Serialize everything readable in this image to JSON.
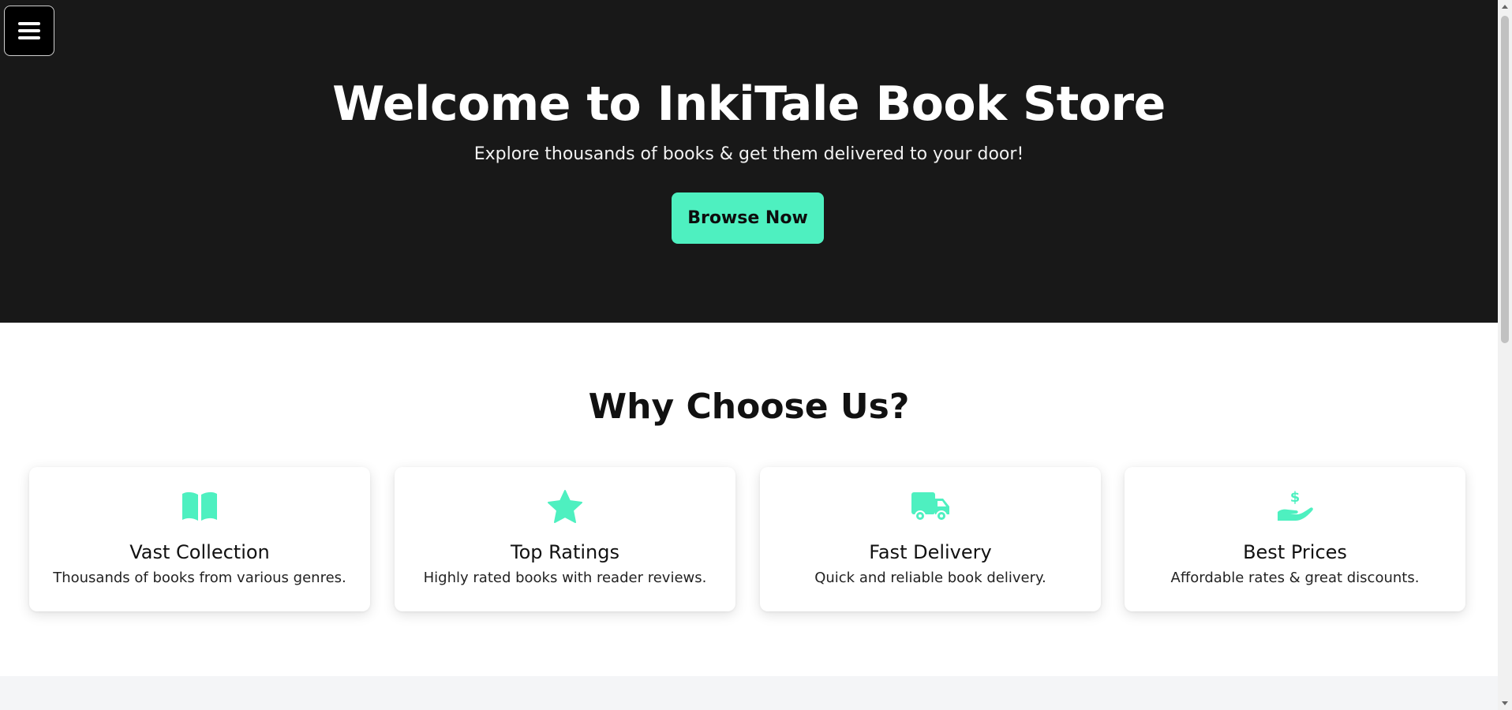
{
  "hero": {
    "title": "Welcome to InkiTale Book Store",
    "subtitle": "Explore thousands of books & get them delivered to your door!",
    "cta_label": "Browse Now",
    "background_color": "#181818"
  },
  "menu": {
    "icon": "hamburger-menu-icon"
  },
  "why": {
    "title": "Why Choose Us?",
    "features": [
      {
        "icon": "open-book-icon",
        "title": "Vast Collection",
        "description": "Thousands of books from various genres."
      },
      {
        "icon": "star-icon",
        "title": "Top Ratings",
        "description": "Highly rated books with reader reviews."
      },
      {
        "icon": "delivery-truck-icon",
        "title": "Fast Delivery",
        "description": "Quick and reliable book delivery."
      },
      {
        "icon": "hand-dollar-icon",
        "title": "Best Prices",
        "description": "Affordable rates & great discounts."
      }
    ]
  },
  "colors": {
    "accent": "#4ef0c0",
    "dark": "#181818",
    "section_gray": "#f4f5f7"
  }
}
